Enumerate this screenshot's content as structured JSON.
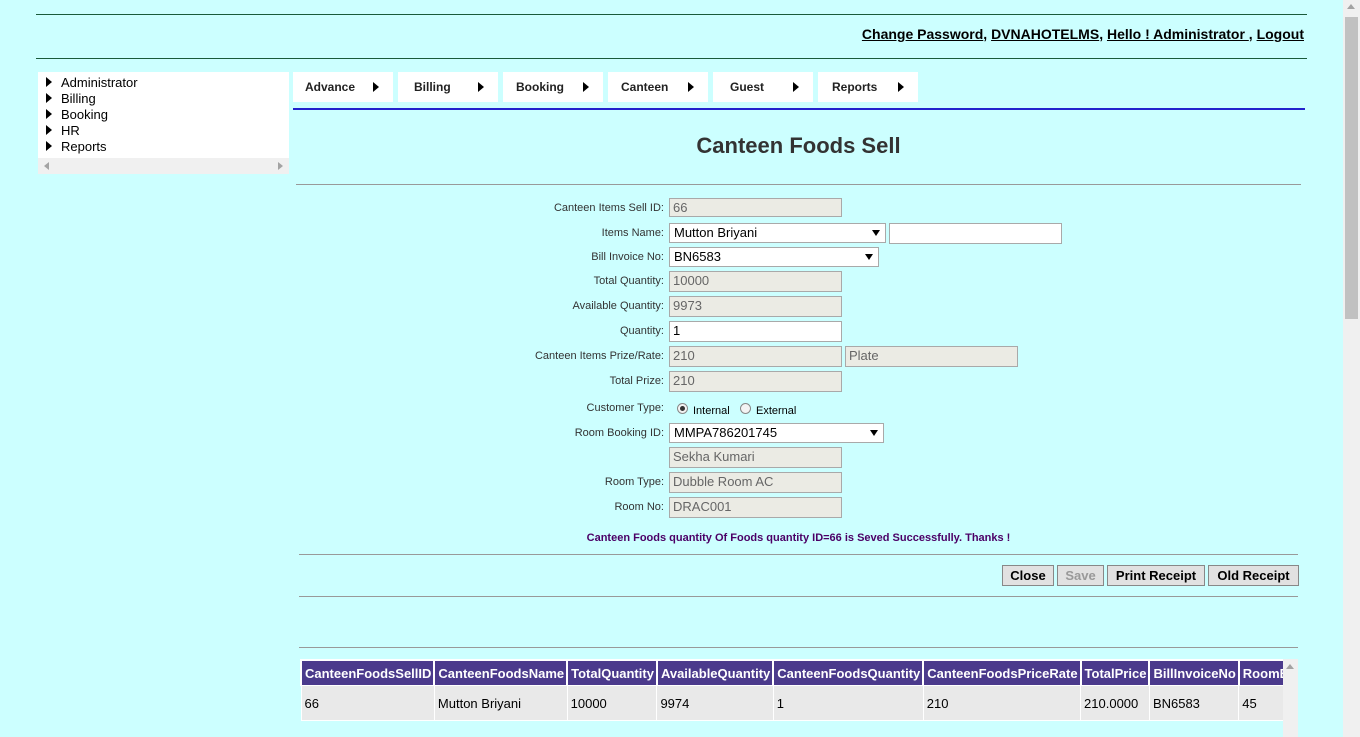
{
  "header": {
    "links": [
      "Change Password",
      "DVNAHOTELMS",
      "Hello ! Administrator ",
      "Logout"
    ]
  },
  "tree": {
    "items": [
      "Administrator",
      "Billing",
      "Booking",
      "HR",
      "Reports"
    ]
  },
  "menu": {
    "items": [
      "Advance",
      "Billing",
      "Booking",
      "Canteen",
      "Guest",
      "Reports"
    ]
  },
  "page": {
    "title": "Canteen Foods Sell"
  },
  "form": {
    "sell_id": {
      "label": "Canteen Items Sell ID:",
      "value": "66"
    },
    "items_name": {
      "label": "Items Name:",
      "value": "Mutton Briyani",
      "search": ""
    },
    "bill_invoice": {
      "label": "Bill Invoice No:",
      "value": "BN6583"
    },
    "total_qty": {
      "label": "Total Quantity:",
      "value": "10000"
    },
    "available_qty": {
      "label": "Available Quantity:",
      "value": "9973"
    },
    "quantity": {
      "label": "Quantity:",
      "value": "1"
    },
    "rate": {
      "label": "Canteen Items Prize/Rate:",
      "value": "210",
      "unit": "Plate"
    },
    "total_prize": {
      "label": "Total Prize:",
      "value": "210"
    },
    "customer_type": {
      "label": "Customer Type:",
      "options": [
        "Internal",
        "External"
      ],
      "selected": "Internal"
    },
    "room_booking": {
      "label": "Room Booking ID:",
      "value": "MMPA786201745"
    },
    "guest_name": {
      "value": "Sekha Kumari"
    },
    "room_type": {
      "label": "Room Type:",
      "value": "Dubble Room AC"
    },
    "room_no": {
      "label": "Room No:",
      "value": "DRAC001"
    }
  },
  "message": "Canteen Foods quantity Of Foods quantity ID=66 is Seved Successfully. Thanks !",
  "buttons": {
    "close": "Close",
    "save": "Save",
    "print": "Print Receipt",
    "old": "Old Receipt"
  },
  "grid": {
    "columns": [
      "CanteenFoodsSellID",
      "CanteenFoodsName",
      "TotalQuantity",
      "AvailableQuantity",
      "CanteenFoodsQuantity",
      "CanteenFoodsPriceRate",
      "TotalPrice",
      "BillInvoiceNo",
      "RoomBookingID"
    ],
    "rows": [
      [
        "66",
        "Mutton Briyani",
        "10000",
        "9974",
        "1",
        "210",
        "210.0000",
        "BN6583",
        "45"
      ]
    ]
  }
}
